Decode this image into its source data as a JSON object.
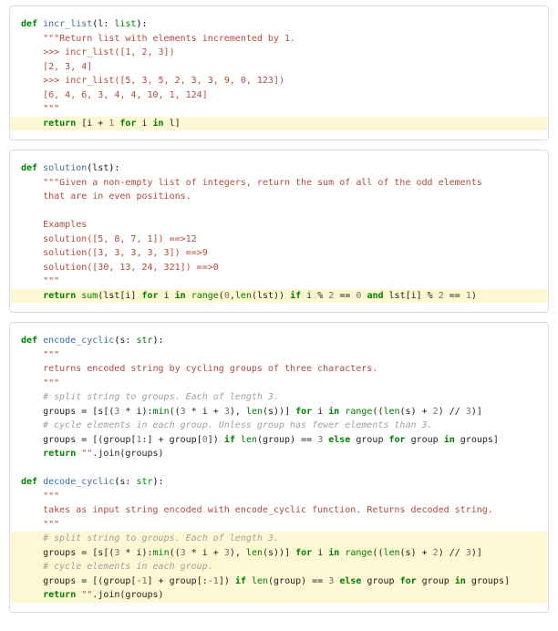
{
  "blocks": [
    {
      "fn_name": "incr_list",
      "param": "l: ",
      "param_type": "list",
      "doc": [
        "\"\"\"Return list with elements incremented by 1.",
        ">>> incr_list([1, 2, 3])",
        "[2, 3, 4]",
        ">>> incr_list([5, 3, 5, 2, 3, 3, 9, 0, 123])",
        "[6, 4, 6, 3, 4, 4, 10, 1, 124]",
        "\"\"\""
      ],
      "body_hl_prefix": "return",
      "body_hl_text": " [i + ",
      "body_hl_num": "1",
      "body_hl_mid": " ",
      "body_hl_for": "for",
      "body_hl_rest1": " i ",
      "body_hl_in": "in",
      "body_hl_rest2": " l]"
    }
  ],
  "block2": {
    "fn_name": "solution",
    "param": "lst",
    "doc": [
      "\"\"\"Given a non-empty list of integers, return the sum of all of the odd elements",
      "that are in even positions.",
      "",
      "Examples",
      "solution([5, 8, 7, 1]) ==>12",
      "solution([3, 3, 3, 3, 3]) ==>9",
      "solution([30, 13, 24, 321]) ==>0",
      "\"\"\""
    ],
    "ret": "return",
    "sum": "sum",
    "t1": "(lst[i] ",
    "for": "for",
    "t2": " i ",
    "in": "in",
    "range": "range",
    "t3": "(",
    "z": "0",
    "t4": ",",
    "len": "len",
    "t5": "(lst)) ",
    "if": "if",
    "t6": " i % ",
    "two": "2",
    "t7": " == ",
    "z2": "0",
    "t8": " ",
    "and": "and",
    "t9": " lst[i] % ",
    "two2": "2",
    "t10": " == ",
    "one": "1",
    "t11": ")"
  },
  "block3": {
    "fn1_name": "encode_cyclic",
    "param1": "s: ",
    "param_type": "str",
    "doc1_open": "\"\"\"",
    "doc1_line": "returns encoded string by cycling groups of three characters.",
    "doc1_close": "\"\"\"",
    "c1": "# split string to groups. Each of length 3.",
    "l1a": "groups = [s[(",
    "three": "3",
    "l1b": " * i):",
    "min": "min",
    "l1c": "((",
    "three2": "3",
    "l1d": " * i + ",
    "three3": "3",
    "l1e": "), ",
    "len1": "len",
    "l1f": "(s))] ",
    "for1": "for",
    "l1g": " i ",
    "in1": "in",
    "l1h": " ",
    "range1": "range",
    "l1i": "((",
    "len2": "len",
    "l1j": "(s) + ",
    "two1": "2",
    "l1k": ") // ",
    "three4": "3",
    "l1l": ")]",
    "c2": "# cycle elements in each group. Unless group has fewer elements than 3.",
    "l2a": "groups = [(group[",
    "one1": "1",
    "l2b": ":] + group[",
    "zero1": "0",
    "l2c": "]) ",
    "if1": "if",
    "l2d": " ",
    "len3": "len",
    "l2e": "(group) == ",
    "three5": "3",
    "l2f": " ",
    "else1": "else",
    "l2g": " group ",
    "for2": "for",
    "l2h": " group ",
    "in2": "in",
    "l2i": " groups]",
    "ret1": "return",
    "l3a": " ",
    "empty1": "\"\"",
    "l3b": ".join(groups)",
    "fn2_name": "decode_cyclic",
    "param2": "s: ",
    "doc2_open": "\"\"\"",
    "doc2_line": "takes as input string encoded with encode_cyclic function. Returns decoded string.",
    "doc2_close": "\"\"\"",
    "hc1": "# split string to groups. Each of length 3.",
    "hl1a": "groups = [s[(",
    "hthree": "3",
    "hl1b": " * i):",
    "hmin": "min",
    "hl1c": "((",
    "hthree2": "3",
    "hl1d": " * i + ",
    "hthree3": "3",
    "hl1e": "), ",
    "hlen1": "len",
    "hl1f": "(s))] ",
    "hfor1": "for",
    "hl1g": " i ",
    "hin1": "in",
    "hl1h": " ",
    "hrange1": "range",
    "hl1i": "((",
    "hlen2": "len",
    "hl1j": "(s) + ",
    "htwo1": "2",
    "hl1k": ") // ",
    "hthree4": "3",
    "hl1l": ")]",
    "hc2": "# cycle elements in each group.",
    "hl2a": "groups = [(group[",
    "hm1": "-",
    "hone1": "1",
    "hl2b": "] + group[:",
    "hm2": "-",
    "hone2": "1",
    "hl2c": "]) ",
    "hif1": "if",
    "hl2d": " ",
    "hlen3": "len",
    "hl2e": "(group) == ",
    "hthree5": "3",
    "hl2f": " ",
    "helse1": "else",
    "hl2g": " group ",
    "hfor2": "for",
    "hl2h": " group ",
    "hin2": "in",
    "hl2i": " groups]",
    "hret": "return",
    "hl3a": " ",
    "hempty": "\"\"",
    "hl3b": ".join(groups)"
  }
}
